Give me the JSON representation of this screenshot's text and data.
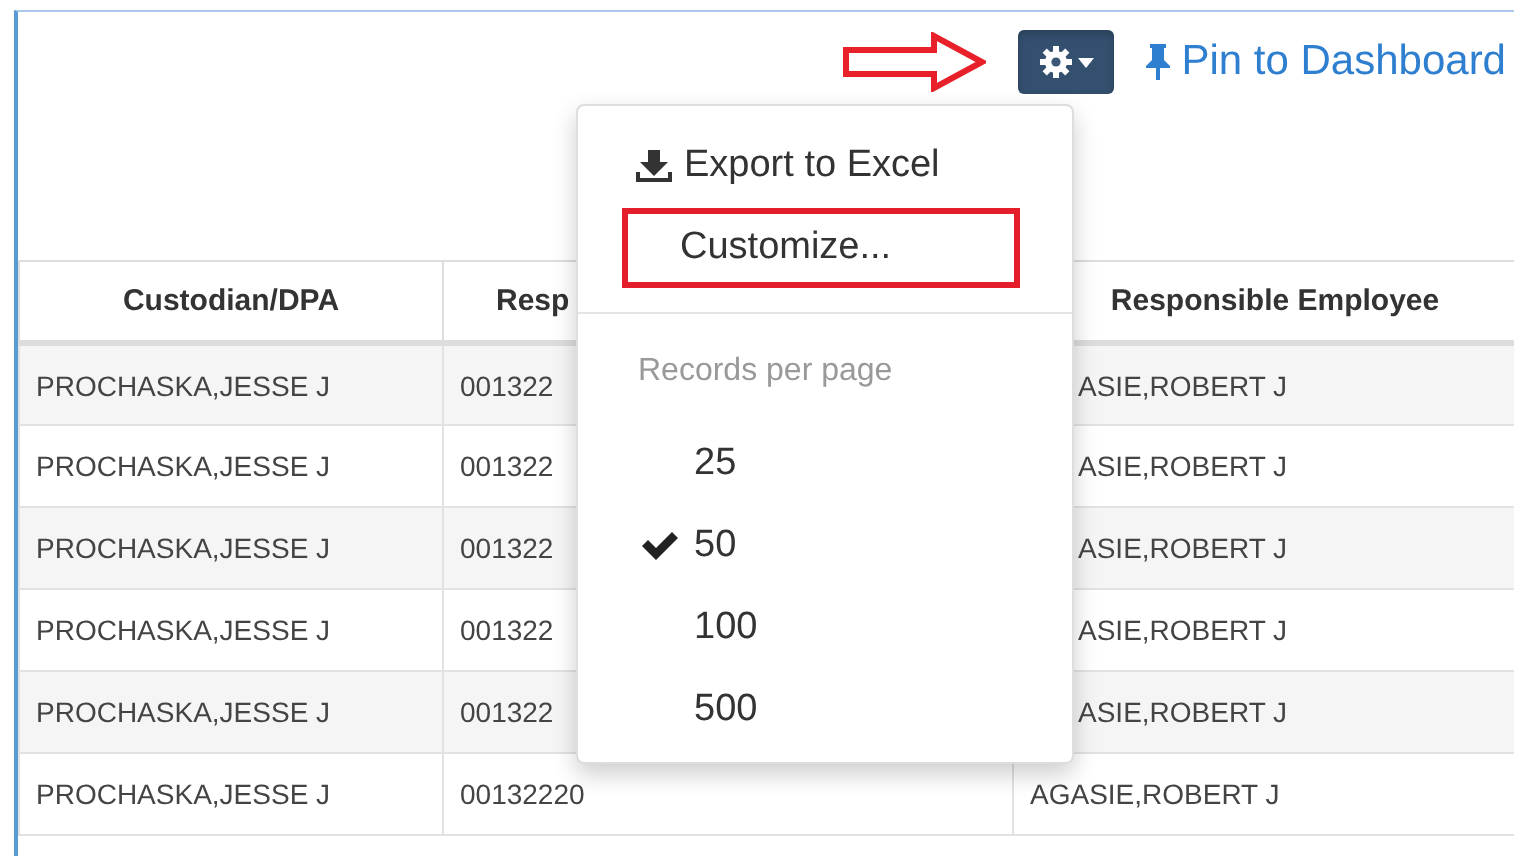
{
  "toolbar": {
    "settings_button": {
      "expanded": true
    },
    "pin_link": {
      "label": "Pin to Dashboard"
    }
  },
  "menu": {
    "actions": [
      {
        "kind": "export",
        "label": "Export to Excel",
        "highlighted": false
      },
      {
        "kind": "action",
        "label": "Customize...",
        "highlighted": true
      }
    ],
    "section_title": "Records per page",
    "page_sizes": [
      {
        "label": "25",
        "selected": false
      },
      {
        "label": "50",
        "selected": true
      },
      {
        "label": "100",
        "selected": false
      },
      {
        "label": "500",
        "selected": false
      }
    ]
  },
  "table": {
    "columns": [
      "Custodian/DPA",
      "Resp",
      "Responsible Employee"
    ],
    "rows": [
      {
        "cells": [
          "PROCHASKA,JESSE J",
          "001322",
          "ASIE,ROBERT J"
        ],
        "under_menu": true
      },
      {
        "cells": [
          "PROCHASKA,JESSE J",
          "001322",
          "ASIE,ROBERT J"
        ],
        "under_menu": true
      },
      {
        "cells": [
          "PROCHASKA,JESSE J",
          "001322",
          "ASIE,ROBERT J"
        ],
        "under_menu": true
      },
      {
        "cells": [
          "PROCHASKA,JESSE J",
          "001322",
          "ASIE,ROBERT J"
        ],
        "under_menu": true
      },
      {
        "cells": [
          "PROCHASKA,JESSE J",
          "001322",
          "ASIE,ROBERT J"
        ],
        "under_menu": true
      },
      {
        "cells": [
          "PROCHASKA,JESSE J",
          "00132220",
          "AGASIE,ROBERT J"
        ],
        "under_menu": false
      }
    ]
  }
}
